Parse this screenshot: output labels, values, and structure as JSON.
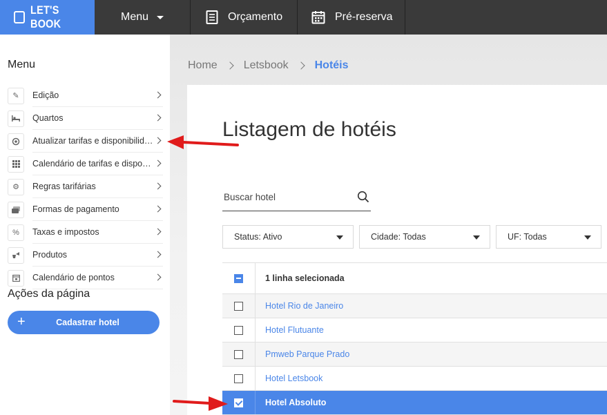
{
  "topbar": {
    "logo": "LET'S BOOK",
    "menu_label": "Menu",
    "orcamento_label": "Orçamento",
    "prereserva_label": "Pré-reserva"
  },
  "sidebar": {
    "title": "Menu",
    "items": [
      {
        "label": "Edição",
        "icon": "pencil-icon"
      },
      {
        "label": "Quartos",
        "icon": "bed-icon"
      },
      {
        "label": "Atualizar tarifas e disponibilidade",
        "icon": "refresh-rates-icon"
      },
      {
        "label": "Calendário de tarifas e disponibilidade",
        "icon": "calendar-grid-icon"
      },
      {
        "label": "Regras tarifárias",
        "icon": "gears-icon"
      },
      {
        "label": "Formas de pagamento",
        "icon": "payment-card-icon"
      },
      {
        "label": "Taxas e impostos",
        "icon": "percent-icon"
      },
      {
        "label": "Produtos",
        "icon": "products-icon"
      },
      {
        "label": "Calendário de pontos",
        "icon": "calendar-points-icon"
      }
    ],
    "actions_title": "Ações da página",
    "primary_action": "Cadastrar hotel"
  },
  "breadcrumb": [
    "Home",
    "Letsbook",
    "Hotéis"
  ],
  "main": {
    "title": "Listagem de hotéis",
    "search_placeholder": "Buscar hotel",
    "filters": [
      "Status: Ativo",
      "Cidade: Todas",
      "UF: Todas"
    ],
    "table_header": "1 linha selecionada",
    "rows": [
      {
        "name": "Hotel Rio de Janeiro",
        "checked": false
      },
      {
        "name": "Hotel Flutuante",
        "checked": false
      },
      {
        "name": "Pmweb Parque Prado",
        "checked": false
      },
      {
        "name": "Hotel Letsbook",
        "checked": false
      },
      {
        "name": "Hotel Absoluto",
        "checked": true
      }
    ]
  },
  "colors": {
    "accent": "#4a86e8",
    "topbar": "#3a3a3a",
    "annotation_arrow": "#e01b1b"
  }
}
